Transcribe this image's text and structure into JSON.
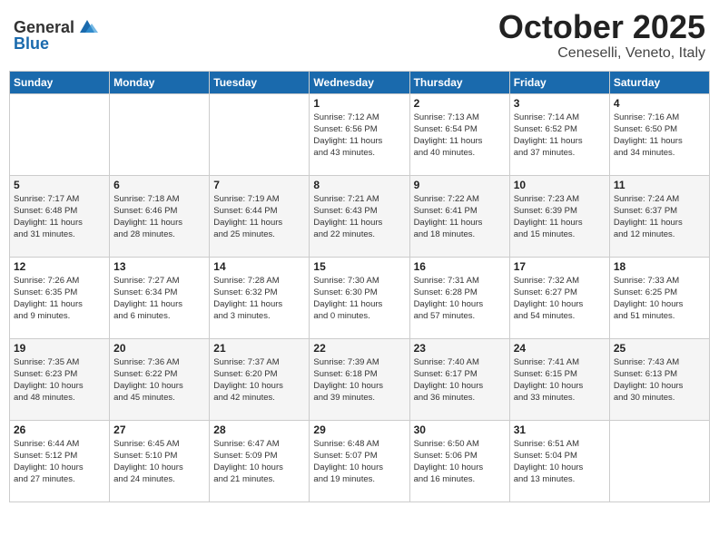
{
  "header": {
    "logo_general": "General",
    "logo_blue": "Blue",
    "month": "October 2025",
    "location": "Ceneselli, Veneto, Italy"
  },
  "days_of_week": [
    "Sunday",
    "Monday",
    "Tuesday",
    "Wednesday",
    "Thursday",
    "Friday",
    "Saturday"
  ],
  "weeks": [
    [
      {
        "day": "",
        "info": ""
      },
      {
        "day": "",
        "info": ""
      },
      {
        "day": "",
        "info": ""
      },
      {
        "day": "1",
        "info": "Sunrise: 7:12 AM\nSunset: 6:56 PM\nDaylight: 11 hours\nand 43 minutes."
      },
      {
        "day": "2",
        "info": "Sunrise: 7:13 AM\nSunset: 6:54 PM\nDaylight: 11 hours\nand 40 minutes."
      },
      {
        "day": "3",
        "info": "Sunrise: 7:14 AM\nSunset: 6:52 PM\nDaylight: 11 hours\nand 37 minutes."
      },
      {
        "day": "4",
        "info": "Sunrise: 7:16 AM\nSunset: 6:50 PM\nDaylight: 11 hours\nand 34 minutes."
      }
    ],
    [
      {
        "day": "5",
        "info": "Sunrise: 7:17 AM\nSunset: 6:48 PM\nDaylight: 11 hours\nand 31 minutes."
      },
      {
        "day": "6",
        "info": "Sunrise: 7:18 AM\nSunset: 6:46 PM\nDaylight: 11 hours\nand 28 minutes."
      },
      {
        "day": "7",
        "info": "Sunrise: 7:19 AM\nSunset: 6:44 PM\nDaylight: 11 hours\nand 25 minutes."
      },
      {
        "day": "8",
        "info": "Sunrise: 7:21 AM\nSunset: 6:43 PM\nDaylight: 11 hours\nand 22 minutes."
      },
      {
        "day": "9",
        "info": "Sunrise: 7:22 AM\nSunset: 6:41 PM\nDaylight: 11 hours\nand 18 minutes."
      },
      {
        "day": "10",
        "info": "Sunrise: 7:23 AM\nSunset: 6:39 PM\nDaylight: 11 hours\nand 15 minutes."
      },
      {
        "day": "11",
        "info": "Sunrise: 7:24 AM\nSunset: 6:37 PM\nDaylight: 11 hours\nand 12 minutes."
      }
    ],
    [
      {
        "day": "12",
        "info": "Sunrise: 7:26 AM\nSunset: 6:35 PM\nDaylight: 11 hours\nand 9 minutes."
      },
      {
        "day": "13",
        "info": "Sunrise: 7:27 AM\nSunset: 6:34 PM\nDaylight: 11 hours\nand 6 minutes."
      },
      {
        "day": "14",
        "info": "Sunrise: 7:28 AM\nSunset: 6:32 PM\nDaylight: 11 hours\nand 3 minutes."
      },
      {
        "day": "15",
        "info": "Sunrise: 7:30 AM\nSunset: 6:30 PM\nDaylight: 11 hours\nand 0 minutes."
      },
      {
        "day": "16",
        "info": "Sunrise: 7:31 AM\nSunset: 6:28 PM\nDaylight: 10 hours\nand 57 minutes."
      },
      {
        "day": "17",
        "info": "Sunrise: 7:32 AM\nSunset: 6:27 PM\nDaylight: 10 hours\nand 54 minutes."
      },
      {
        "day": "18",
        "info": "Sunrise: 7:33 AM\nSunset: 6:25 PM\nDaylight: 10 hours\nand 51 minutes."
      }
    ],
    [
      {
        "day": "19",
        "info": "Sunrise: 7:35 AM\nSunset: 6:23 PM\nDaylight: 10 hours\nand 48 minutes."
      },
      {
        "day": "20",
        "info": "Sunrise: 7:36 AM\nSunset: 6:22 PM\nDaylight: 10 hours\nand 45 minutes."
      },
      {
        "day": "21",
        "info": "Sunrise: 7:37 AM\nSunset: 6:20 PM\nDaylight: 10 hours\nand 42 minutes."
      },
      {
        "day": "22",
        "info": "Sunrise: 7:39 AM\nSunset: 6:18 PM\nDaylight: 10 hours\nand 39 minutes."
      },
      {
        "day": "23",
        "info": "Sunrise: 7:40 AM\nSunset: 6:17 PM\nDaylight: 10 hours\nand 36 minutes."
      },
      {
        "day": "24",
        "info": "Sunrise: 7:41 AM\nSunset: 6:15 PM\nDaylight: 10 hours\nand 33 minutes."
      },
      {
        "day": "25",
        "info": "Sunrise: 7:43 AM\nSunset: 6:13 PM\nDaylight: 10 hours\nand 30 minutes."
      }
    ],
    [
      {
        "day": "26",
        "info": "Sunrise: 6:44 AM\nSunset: 5:12 PM\nDaylight: 10 hours\nand 27 minutes."
      },
      {
        "day": "27",
        "info": "Sunrise: 6:45 AM\nSunset: 5:10 PM\nDaylight: 10 hours\nand 24 minutes."
      },
      {
        "day": "28",
        "info": "Sunrise: 6:47 AM\nSunset: 5:09 PM\nDaylight: 10 hours\nand 21 minutes."
      },
      {
        "day": "29",
        "info": "Sunrise: 6:48 AM\nSunset: 5:07 PM\nDaylight: 10 hours\nand 19 minutes."
      },
      {
        "day": "30",
        "info": "Sunrise: 6:50 AM\nSunset: 5:06 PM\nDaylight: 10 hours\nand 16 minutes."
      },
      {
        "day": "31",
        "info": "Sunrise: 6:51 AM\nSunset: 5:04 PM\nDaylight: 10 hours\nand 13 minutes."
      },
      {
        "day": "",
        "info": ""
      }
    ]
  ]
}
